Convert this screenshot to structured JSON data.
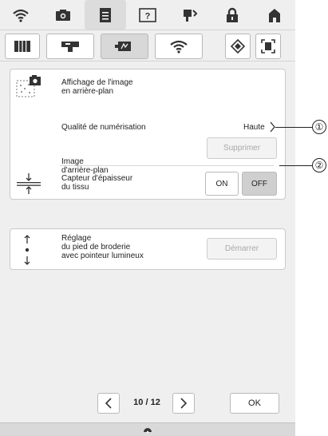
{
  "topbar": {
    "icons": [
      "wifi-icon",
      "camera-icon",
      "document-icon",
      "help-icon",
      "sewing-tips-icon",
      "lock-icon",
      "home-icon"
    ]
  },
  "tabs": [
    "book-icon",
    "sewing-machine-icon",
    "embroidery-frame-icon",
    "wireless-icon"
  ],
  "right_icons": [
    "eraser-icon",
    "frame-view-icon"
  ],
  "settings": {
    "background_image_label": "Affichage de l'image\nen arrière-plan",
    "scan_quality_label": "Qualité de numérisation",
    "scan_quality_value": "Haute",
    "background_image_item_label": "Image\nd'arrière-plan",
    "delete_button": "Supprimer",
    "fabric_thickness_label": "Capteur d'épaisseur\ndu tissu",
    "on_label": "ON",
    "off_label": "OFF",
    "off_selected": true,
    "pointer_label": "Réglage\ndu pied de broderie\navec pointeur lumineux",
    "start_button": "Démarrer"
  },
  "footer": {
    "page_indicator": "10 / 12",
    "ok_label": "OK"
  },
  "callouts": [
    "①",
    "②"
  ]
}
